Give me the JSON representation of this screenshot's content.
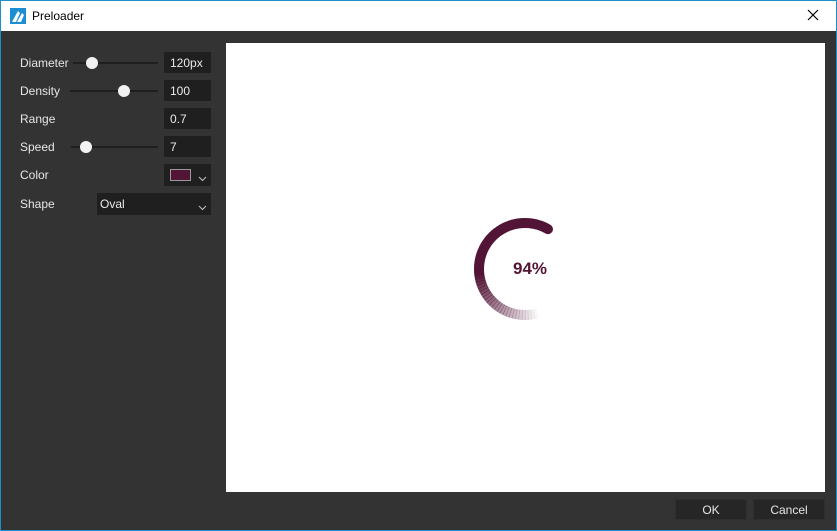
{
  "window": {
    "title": "Preloader"
  },
  "settings": {
    "diameter": {
      "label": "Diameter",
      "value": "120px",
      "slider_level": 0.25
    },
    "density": {
      "label": "Density",
      "value": "100",
      "slider_level": 0.6
    },
    "range": {
      "label": "Range",
      "value": "0.7"
    },
    "speed": {
      "label": "Speed",
      "value": "7",
      "slider_level": 0.16
    },
    "color": {
      "label": "Color",
      "value": "#521536"
    },
    "shape": {
      "label": "Shape",
      "value": "Oval"
    }
  },
  "preview": {
    "percent_text": "94%",
    "progress": 0.94,
    "color": "#521536"
  },
  "buttons": {
    "ok": "OK",
    "cancel": "Cancel"
  },
  "icons": {
    "app": "app-logo-icon",
    "close": "close-icon",
    "dropdown": "chevron-down-icon"
  }
}
